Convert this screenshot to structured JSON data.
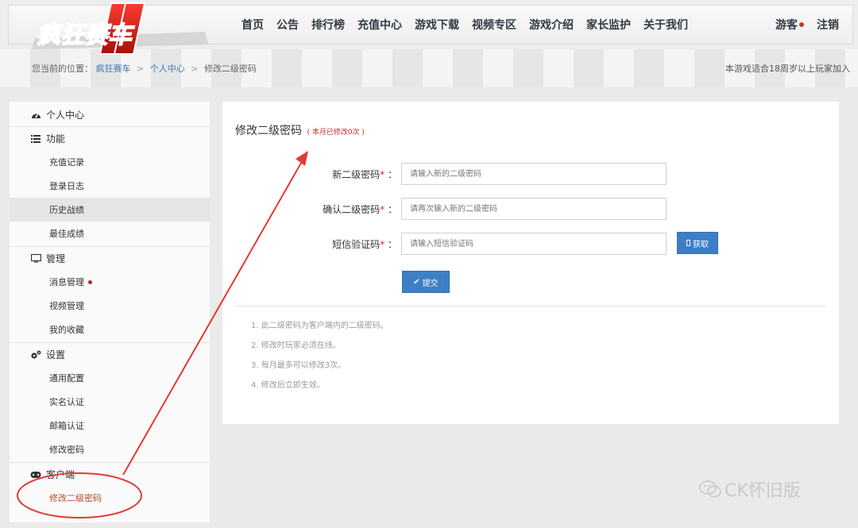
{
  "logo": {
    "text": "疯狂赛车"
  },
  "nav": {
    "items": [
      "首页",
      "公告",
      "排行榜",
      "充值中心",
      "游戏下载",
      "视频专区",
      "游戏介绍",
      "家长监护",
      "关于我们"
    ],
    "user": "游客",
    "logout": "注销"
  },
  "breadcrumb": {
    "prefix": "您当前的位置：",
    "items": [
      "疯狂赛车",
      "个人中心",
      "修改二级密码"
    ],
    "separator": ">"
  },
  "age_note": "本游戏适合18周岁以上玩家加入",
  "sidebar": {
    "sections": [
      {
        "label": "个人中心",
        "icon": "dashboard-icon"
      },
      {
        "label": "功能",
        "icon": "list-icon"
      },
      {
        "label": "管理",
        "icon": "monitor-icon"
      },
      {
        "label": "设置",
        "icon": "gears-icon"
      },
      {
        "label": "客户端",
        "icon": "gamepad-icon"
      }
    ],
    "items": {
      "func": [
        "充值记录",
        "登录日志",
        "历史战绩",
        "最佳成绩"
      ],
      "manage": [
        "消息管理",
        "视频管理",
        "我的收藏"
      ],
      "settings": [
        "通用配置",
        "实名认证",
        "邮箱认证",
        "修改密码"
      ],
      "client": [
        "修改二级密码"
      ]
    }
  },
  "panel": {
    "title": "修改二级密码",
    "note": "( 本月已修改0次 )",
    "fields": [
      {
        "label": "新二级密码",
        "placeholder": "请输入新的二级密码"
      },
      {
        "label": "确认二级密码",
        "placeholder": "请再次输入新的二级密码"
      },
      {
        "label": "短信验证码",
        "placeholder": "请输入短信验证码"
      }
    ],
    "required_mark": "*",
    "colon": "：",
    "sms_button": "获取",
    "submit_button": "提交",
    "notes": [
      "1. 此二级密码为客户端内的二级密码。",
      "2. 修改时玩家必须在线。",
      "3. 每月最多可以修改3次。",
      "4. 修改后立即生效。"
    ]
  },
  "watermark": "CK怀旧版",
  "colors": {
    "accent": "#3d7fc6",
    "annotation": "#e53935",
    "active": "#b9472f"
  }
}
